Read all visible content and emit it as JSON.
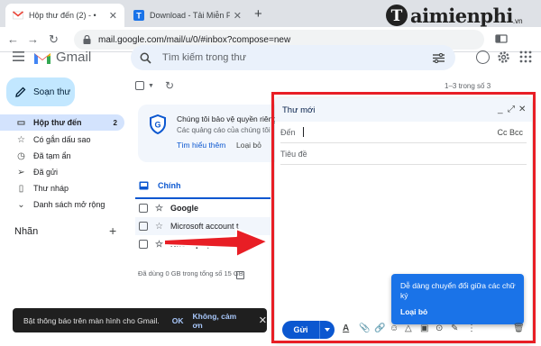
{
  "browser": {
    "tabs": [
      {
        "label": "Hộp thư đến (2) - •",
        "active": true,
        "favicon": "gmail-icon"
      },
      {
        "label": "Download - Tải Miễn Phí VN - Ph",
        "active": false,
        "favicon": "taimienphi-icon"
      }
    ],
    "address": "mail.google.com/mail/u/0/#inbox?compose=new"
  },
  "gmail": {
    "brand": "Gmail",
    "search_placeholder": "Tìm kiếm trong thư",
    "compose_label": "Soạn thư",
    "nav": [
      {
        "label": "Hộp thư đến",
        "count": "2",
        "icon": "inbox-icon",
        "active": true
      },
      {
        "label": "Có gắn dấu sao",
        "count": "",
        "icon": "star-icon",
        "active": false
      },
      {
        "label": "Đã tạm ẩn",
        "count": "",
        "icon": "clock-icon",
        "active": false
      },
      {
        "label": "Đã gửi",
        "count": "",
        "icon": "send-icon",
        "active": false
      },
      {
        "label": "Thư nháp",
        "count": "",
        "icon": "draft-icon",
        "active": false
      },
      {
        "label": "Danh sách mở rộng",
        "count": "",
        "icon": "chevron-down-icon",
        "active": false
      }
    ],
    "labels_heading": "Nhãn",
    "pager": "1–3 trong số 3",
    "promo": {
      "title": "Chúng tôi bảo vệ quyền riêng",
      "subtitle": "Các quảng cáo của chúng tôi",
      "learn_more": "Tìm hiểu thêm",
      "dismiss": "Loại bỏ"
    },
    "primary_tab": "Chính",
    "emails": [
      {
        "sender": "Google",
        "unread": true
      },
      {
        "sender": "Microsoft account t",
        "unread": false
      },
      {
        "sender": "Nhóm phụ trách cộ",
        "unread": true
      }
    ],
    "storage": "Đã dùng 0 GB trong tổng số 15 GB",
    "snackbar": {
      "message": "Bật thông báo trên màn hình cho Gmail.",
      "ok": "OK",
      "no": "Không, cảm ơn"
    }
  },
  "compose": {
    "title": "Thư mới",
    "to_label": "Đến",
    "cc_bcc": "Cc Bcc",
    "subject_placeholder": "Tiêu đề",
    "tooltip_text": "Dễ dàng chuyển đổi giữa các chữ ký",
    "tooltip_dismiss": "Loại bỏ",
    "send_label": "Gửi"
  },
  "watermark": {
    "text": "aimienphi",
    "suffix": ".vn"
  },
  "colors": {
    "highlight": "#e81e25",
    "compose_button": "#c2e7ff",
    "active_nav": "#d3e3fd",
    "send_button": "#0b57d0",
    "tooltip": "#1a73e8"
  }
}
